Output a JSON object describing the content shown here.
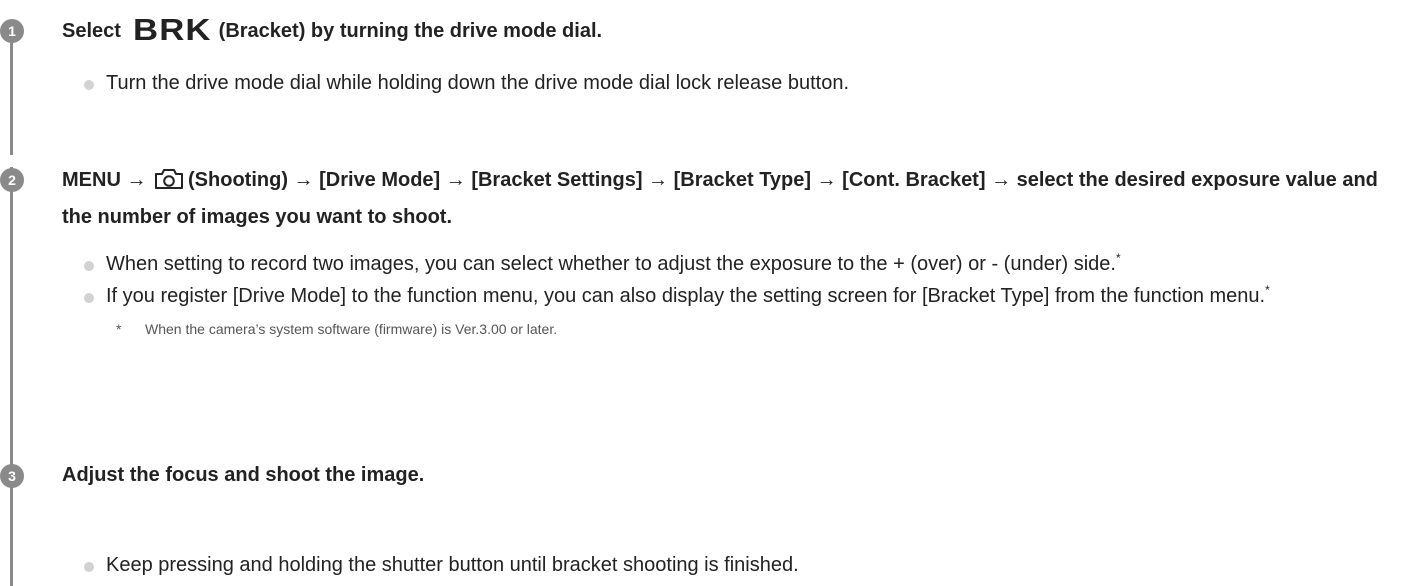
{
  "steps": [
    {
      "number": "1",
      "title_prefix": "Select",
      "title_icon_text": "BRK",
      "title_suffix": "(Bracket) by turning the drive mode dial.",
      "bullets": [
        "Turn the drive mode dial while holding down the drive mode dial lock release button."
      ]
    },
    {
      "number": "2",
      "title_part1": "MENU →",
      "title_icon": "camera-icon",
      "title_part2": "(Shooting) → [Drive Mode] → [Bracket Settings] → [Bracket Type] → [Cont. Bracket] → select the desired exposure value and the number of images you want to shoot.",
      "bullets": [
        "When setting to record two images, you can select whether to adjust the exposure to the + (over) or - (under) side.",
        "If you register [Drive Mode] to the function menu, you can also display the setting screen for [Bracket Type] from the function menu."
      ],
      "footnote_mark": "*",
      "footnote": "When the camera’s system software (firmware) is Ver.3.00 or later."
    },
    {
      "number": "3",
      "title": "Adjust the focus and shoot the image.",
      "bullets": [
        "Keep pressing and holding the shutter button until bracket shooting is finished."
      ]
    }
  ],
  "colors": {
    "step_marker": "#8a8a8a",
    "bullet_dot": "#d2d2d2",
    "text": "#222222",
    "footnote_text": "#555555"
  }
}
